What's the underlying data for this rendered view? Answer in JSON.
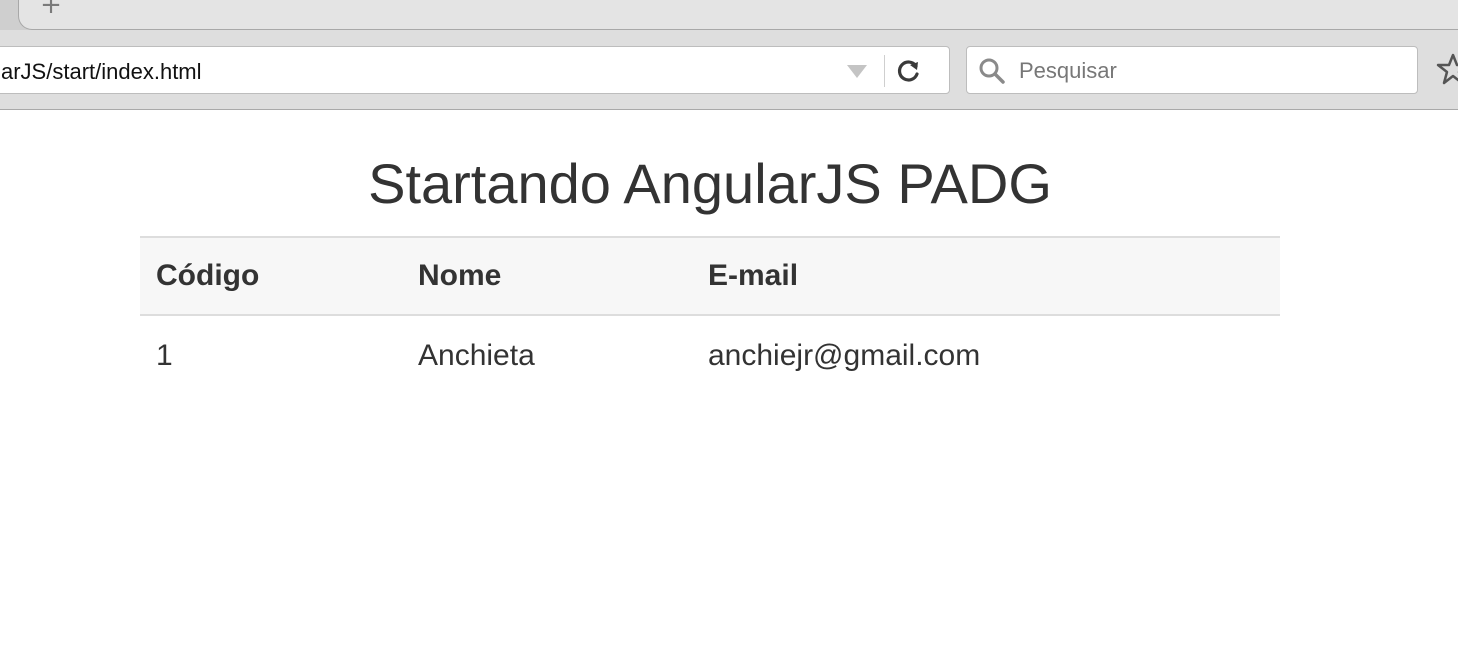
{
  "browser": {
    "new_tab_symbol": "+",
    "address_bar": {
      "url_text": "arJS/start/index.html"
    },
    "search_bar": {
      "placeholder": "Pesquisar"
    },
    "icons": [
      "new-tab-icon",
      "dropdown-arrow-icon",
      "reload-icon",
      "search-icon",
      "bookmark-star-icon"
    ]
  },
  "page": {
    "title": "Startando AngularJS PADG",
    "table": {
      "headers": [
        "Código",
        "Nome",
        "E-mail"
      ],
      "rows": [
        [
          "1",
          "Anchieta",
          "anchiejr@gmail.com"
        ]
      ]
    }
  },
  "colors": {
    "text": "#333333",
    "header_bg": "#f7f7f7",
    "border": "#dddddd",
    "chrome_bg": "#dedede"
  }
}
